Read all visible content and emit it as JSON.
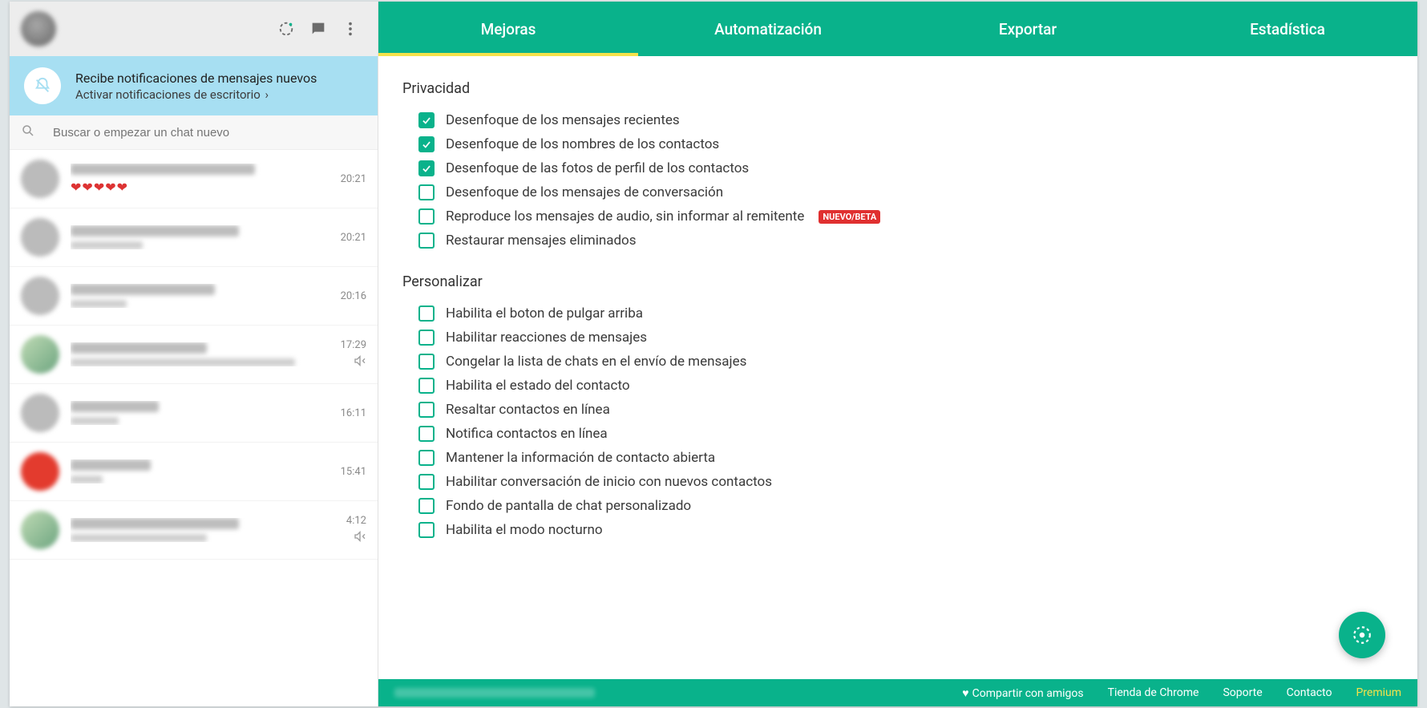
{
  "sidebar": {
    "notification": {
      "title": "Recibe notificaciones de mensajes nuevos",
      "subtitle": "Activar notificaciones de escritorio"
    },
    "search": {
      "placeholder": "Buscar o empezar un chat nuevo"
    },
    "chats": [
      {
        "time": "20:21",
        "muted": false,
        "hearts": true,
        "avatar": "default",
        "nameW": 230,
        "subW": 60
      },
      {
        "time": "20:21",
        "muted": false,
        "hearts": false,
        "avatar": "default",
        "nameW": 210,
        "subW": 90
      },
      {
        "time": "20:16",
        "muted": false,
        "hearts": false,
        "avatar": "default",
        "nameW": 180,
        "subW": 70
      },
      {
        "time": "17:29",
        "muted": true,
        "hearts": false,
        "avatar": "green",
        "nameW": 170,
        "subW": 280
      },
      {
        "time": "16:11",
        "muted": false,
        "hearts": false,
        "avatar": "default",
        "nameW": 110,
        "subW": 60
      },
      {
        "time": "15:41",
        "muted": false,
        "hearts": false,
        "avatar": "red",
        "nameW": 100,
        "subW": 40
      },
      {
        "time": "4:12",
        "muted": true,
        "hearts": false,
        "avatar": "green",
        "nameW": 210,
        "subW": 170
      }
    ]
  },
  "tabs": [
    {
      "label": "Mejoras",
      "active": true
    },
    {
      "label": "Automatización",
      "active": false
    },
    {
      "label": "Exportar",
      "active": false
    },
    {
      "label": "Estadística",
      "active": false
    }
  ],
  "settings": {
    "sections": [
      {
        "title": "Privacidad",
        "options": [
          {
            "label": "Desenfoque de los mensajes recientes",
            "checked": true
          },
          {
            "label": "Desenfoque de los nombres de los contactos",
            "checked": true
          },
          {
            "label": "Desenfoque de las fotos de perfil de los contactos",
            "checked": true
          },
          {
            "label": "Desenfoque de los mensajes de conversación",
            "checked": false
          },
          {
            "label": "Reproduce los mensajes de audio, sin informar al remitente",
            "checked": false,
            "badge": "NUEVO/BETA"
          },
          {
            "label": "Restaurar mensajes eliminados",
            "checked": false
          }
        ]
      },
      {
        "title": "Personalizar",
        "options": [
          {
            "label": "Habilita el boton de pulgar arriba",
            "checked": false
          },
          {
            "label": "Habilitar reacciones de mensajes",
            "checked": false
          },
          {
            "label": "Congelar la lista de chats en el envío de mensajes",
            "checked": false
          },
          {
            "label": "Habilita el estado del contacto",
            "checked": false
          },
          {
            "label": "Resaltar contactos en línea",
            "checked": false
          },
          {
            "label": "Notifica contactos en línea",
            "checked": false
          },
          {
            "label": "Mantener la información de contacto abierta",
            "checked": false
          },
          {
            "label": "Habilitar conversación de inicio con nuevos contactos",
            "checked": false
          },
          {
            "label": "Fondo de pantalla de chat personalizado",
            "checked": false
          },
          {
            "label": "Habilita el modo nocturno",
            "checked": false
          }
        ]
      }
    ]
  },
  "footer": {
    "share": "Compartir con amigos",
    "store": "Tienda de Chrome",
    "support": "Soporte",
    "contact": "Contacto",
    "premium": "Premium"
  }
}
